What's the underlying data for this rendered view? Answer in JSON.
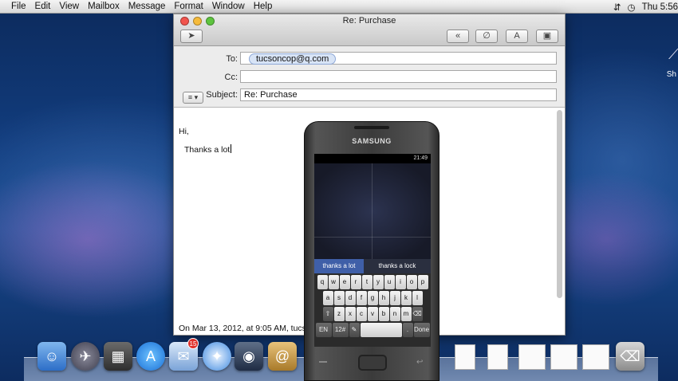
{
  "menubar": {
    "items": [
      "File",
      "Edit",
      "View",
      "Mailbox",
      "Message",
      "Format",
      "Window",
      "Help"
    ],
    "clock": "Thu 5:56"
  },
  "desktop": {
    "drive_label": "Sh"
  },
  "window": {
    "title": "Re: Purchase",
    "to_label": "To:",
    "to_value": "tucsoncop@q.com",
    "cc_label": "Cc:",
    "cc_value": "",
    "subject_label": "Subject:",
    "subject_value": "Re: Purchase",
    "body_line1": "Hi,",
    "body_line2": "Thanks a lot",
    "quote_line": "On Mar 13, 2012, at 9:05 AM, tucsonco"
  },
  "dock": {
    "mail_badge": "15"
  },
  "phone": {
    "brand": "SAMSUNG",
    "status_time": "21:49",
    "suggestion_1": "thanks a lot",
    "suggestion_2": "thanks a lock",
    "keys_row1": [
      "q",
      "w",
      "e",
      "r",
      "t",
      "y",
      "u",
      "i",
      "o",
      "p"
    ],
    "keys_row2": [
      "a",
      "s",
      "d",
      "f",
      "g",
      "h",
      "j",
      "k",
      "l"
    ],
    "keys_row3": [
      "z",
      "x",
      "c",
      "v",
      "b",
      "n",
      "m"
    ],
    "key_en": "EN",
    "key_sym": "12#",
    "key_done": "Done"
  }
}
